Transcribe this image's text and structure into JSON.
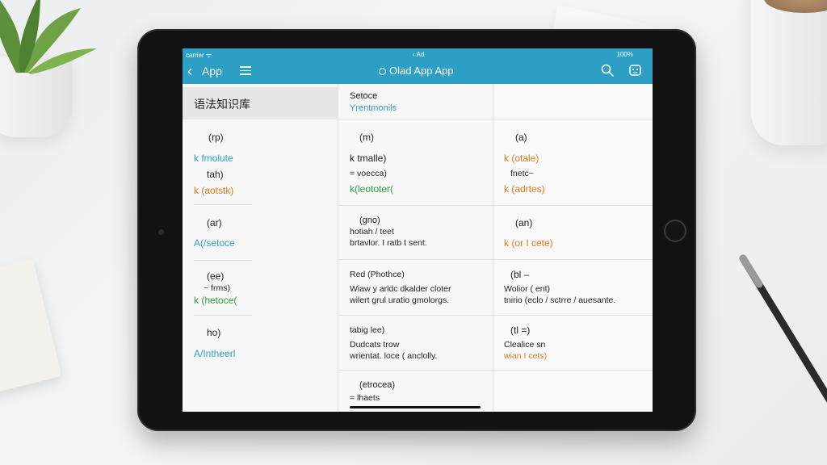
{
  "status_bar": {
    "left": " ⁠ ⁠⁠ ⁠⁠ 𝗧 ⁠ ",
    "middle": "",
    "right": ""
  },
  "nav": {
    "back_label": "App",
    "title": "Olad App App"
  },
  "status": {
    "left": "carrier ᯤ",
    "mid": "‹ Ad",
    "right": "100%"
  },
  "left_column": {
    "header": "语法知识库",
    "entries": [
      {
        "lines": [
          {
            "text": "(rp)",
            "color": "#222222"
          },
          {
            "text": "k fmolute",
            "color": "#2e9fc4"
          },
          {
            "text": "tah)",
            "color": "#222222"
          },
          {
            "text": "k (aotstk)",
            "color": "#e07b1e"
          }
        ]
      },
      {
        "lines": [
          {
            "text": "(ar)",
            "color": "#222222"
          },
          {
            "text": "A(/setoce",
            "color": "#2e9fc4"
          }
        ]
      },
      {
        "lines": [
          {
            "text": "(ee)",
            "color": "#222222"
          },
          {
            "text": "~ frms)",
            "color": "#222222"
          },
          {
            "text": "k (hetoce(",
            "color": "#2f9b44"
          }
        ]
      },
      {
        "lines": [
          {
            "text": "ho)",
            "color": "#222222"
          },
          {
            "text": "A/Intheerl",
            "color": "#2e9fc4"
          }
        ]
      }
    ]
  },
  "mid_column": {
    "header_title": "Setoce",
    "header_subtitle": "Yrentmonils",
    "entries": [
      {
        "lines": [
          {
            "text": "(m)",
            "color": "#222222"
          },
          {
            "text": "k tmalle)",
            "color": "#222222"
          },
          {
            "text": "= voecca)",
            "color": "#222222"
          },
          {
            "text": "k(leototer(",
            "color": "#2f9b44"
          }
        ]
      },
      {
        "lines": [
          {
            "text": "(gno)",
            "color": "#222222"
          },
          {
            "text": "hotiah / teet",
            "color": "#222222"
          },
          {
            "text": "brtavlor. I ratb t sent.",
            "color": "#222222"
          }
        ]
      },
      {
        "lines": [
          {
            "text": "Red (Phothce)",
            "color": "#222222"
          },
          {
            "text": "Wiaw y arldc dkalder cloter",
            "color": "#222222"
          },
          {
            "text": "wilert grul uratio gmolorgs.",
            "color": "#222222"
          }
        ]
      },
      {
        "lines": [
          {
            "text": "tabig lee)",
            "color": "#222222"
          },
          {
            "text": "Dudcats trow",
            "color": "#222222"
          },
          {
            "text": "wrientat. loce ( anclolly.",
            "color": "#222222"
          }
        ]
      },
      {
        "lines": [
          {
            "text": "(etrocea)",
            "color": "#222222"
          },
          {
            "text": "= lhaets",
            "color": "#222222"
          }
        ]
      }
    ]
  },
  "right_column": {
    "entries": [
      {
        "lines": [
          {
            "text": "(a)",
            "color": "#222222"
          },
          {
            "text": "k (otale)",
            "color": "#e07b1e"
          },
          {
            "text": "fnetc~",
            "color": "#222222"
          },
          {
            "text": "k (adrtes)",
            "color": "#e07b1e"
          }
        ]
      },
      {
        "lines": [
          {
            "text": "(an)",
            "color": "#222222"
          },
          {
            "text": "k (or I cete)",
            "color": "#e07b1e"
          }
        ]
      },
      {
        "lines": [
          {
            "text": "(bl –",
            "color": "#222222"
          },
          {
            "text": "Wolior ( ent)",
            "color": "#222222"
          },
          {
            "text": "tnirio (eclo / sctrre / auesante.",
            "color": "#222222"
          }
        ]
      },
      {
        "lines": [
          {
            "text": "(tl =)",
            "color": "#222222"
          },
          {
            "text": "Clealice sn",
            "color": "#222222"
          },
          {
            "text": "wian I cets)",
            "color": "#e07b1e"
          }
        ]
      }
    ]
  },
  "colors": {
    "accent": "#2e9fc4",
    "orange": "#e07b1e",
    "green": "#2f9b44"
  }
}
